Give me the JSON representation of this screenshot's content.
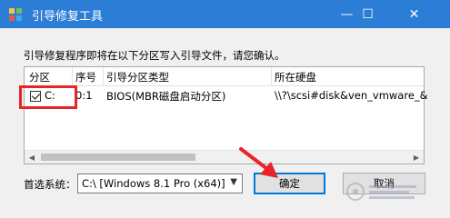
{
  "window": {
    "title": "引导修复工具",
    "minimize_glyph": "—",
    "maximize_glyph": "☐",
    "close_glyph": "✕"
  },
  "instruction": "引导修复程序即将在以下分区写入引导文件，请您确认。",
  "table": {
    "headers": [
      "分区",
      "序号",
      "引导分区类型",
      "所在硬盘"
    ],
    "rows": [
      {
        "checked": true,
        "partition": "C:",
        "index": "0:1",
        "type": "BIOS(MBR磁盘启动分区)",
        "disk": "\\\\?\\scsi#disk&ven_vmware_&"
      }
    ]
  },
  "system_label": "首选系统：",
  "system_select": "C:\\ [Windows 8.1 Pro (x64)]",
  "buttons": {
    "ok": "确定",
    "cancel": "取消"
  },
  "colors": {
    "titlebar": "#2b7dd6",
    "highlight": "#e8232a",
    "accent": "#0078d7"
  }
}
